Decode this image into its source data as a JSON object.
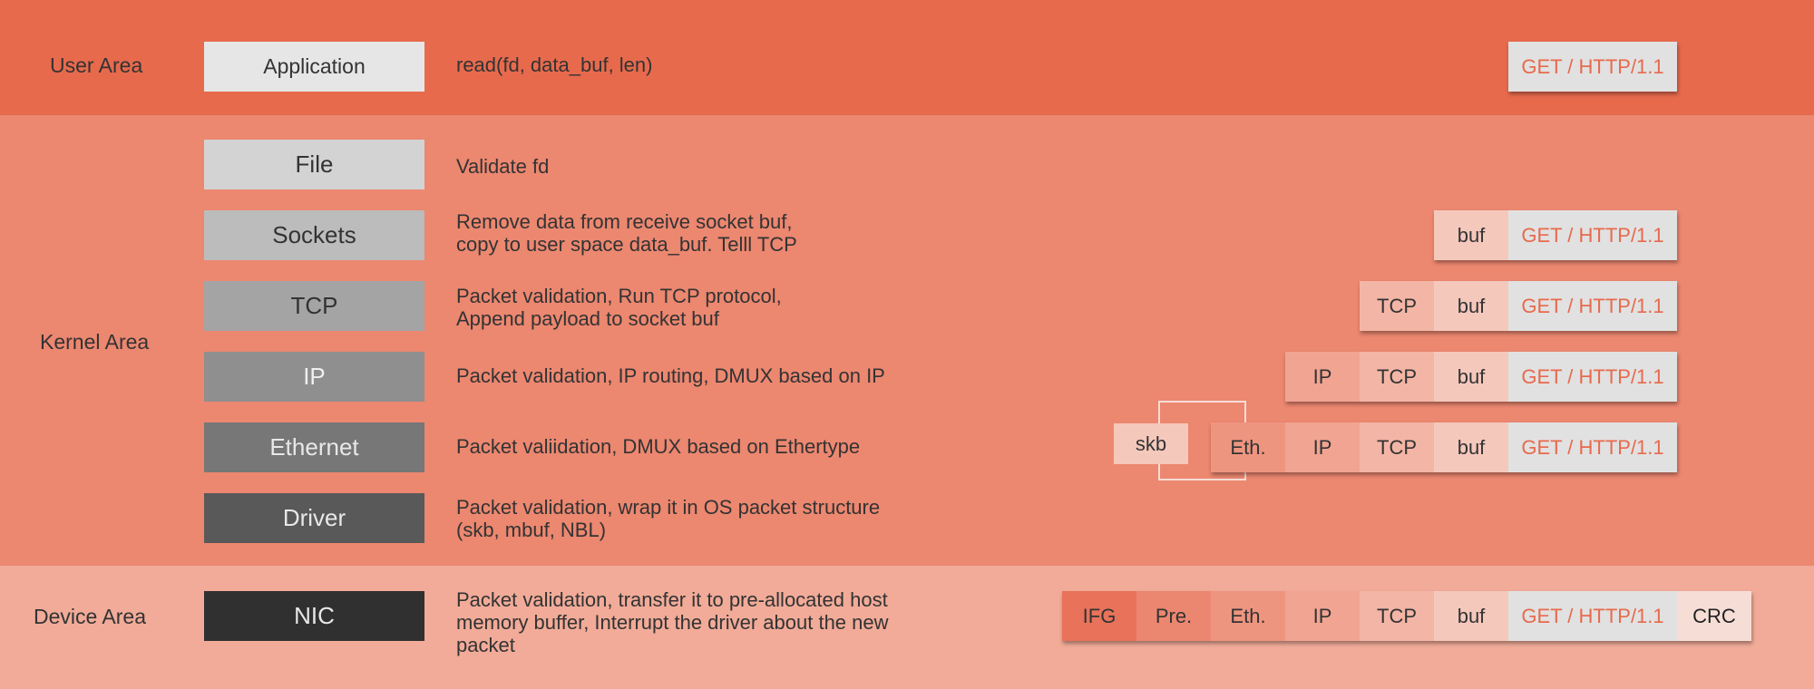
{
  "areas": {
    "user": "User Area",
    "kernel": "Kernel Area",
    "device": "Device Area"
  },
  "layers": {
    "application": "Application",
    "file": "File",
    "sockets": "Sockets",
    "tcp": "TCP",
    "ip": "IP",
    "ethernet": "Ethernet",
    "driver": "Driver",
    "nic": "NIC"
  },
  "descriptions": {
    "application": "read(fd, data_buf, len)",
    "file": "Validate fd",
    "sockets_1": "Remove data from receive socket buf,",
    "sockets_2": "copy to user space data_buf. Telll TCP",
    "tcp_1": "Packet validation, Run TCP protocol,",
    "tcp_2": "Append payload to socket buf",
    "ip": "Packet validation, IP routing, DMUX based on IP",
    "ethernet": "Packet valiidation, DMUX based on Ethertype",
    "driver_1": "Packet validation, wrap it in OS packet structure",
    "driver_2": "(skb, mbuf, NBL)",
    "nic_1": "Packet validation, transfer it to pre-allocated host",
    "nic_2": "memory buffer, Interrupt the driver about the new",
    "nic_3": "packet"
  },
  "packet": {
    "http": "GET / HTTP/1.1",
    "buf": "buf",
    "tcp": "TCP",
    "ip": "IP",
    "eth": "Eth.",
    "pre": "Pre.",
    "ifg": "IFG",
    "crc": "CRC",
    "skb": "skb"
  },
  "colors": {
    "user_band": "#e76a4d",
    "kernel_band": "#ec8770",
    "device_band": "#f1ab98",
    "http_text": "#e76a4d"
  }
}
